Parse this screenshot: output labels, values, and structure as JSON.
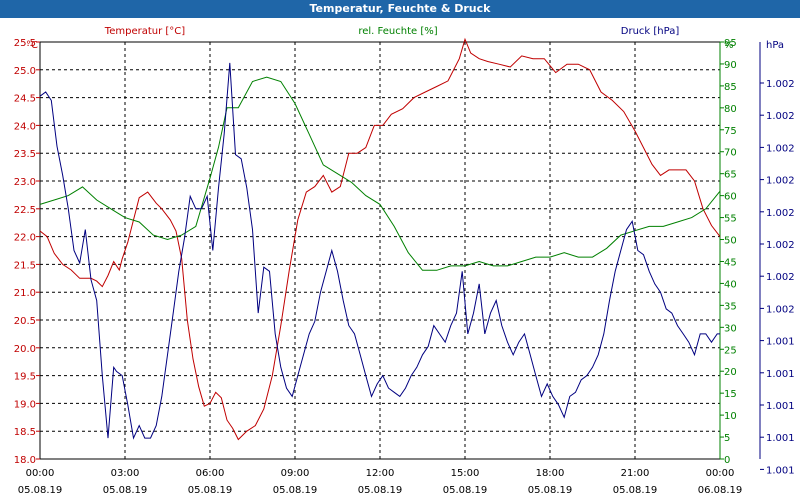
{
  "window": {
    "title": "Temperatur, Feuchte & Druck"
  },
  "chart_data": {
    "type": "line",
    "title": "Temperatur, Feuchte & Druck",
    "x_labels": [
      {
        "hour": 0,
        "time": "00:00",
        "date": "05.08.19"
      },
      {
        "hour": 3,
        "time": "03:00",
        "date": "05.08.19"
      },
      {
        "hour": 6,
        "time": "06:00",
        "date": "05.08.19"
      },
      {
        "hour": 9,
        "time": "09:00",
        "date": "05.08.19"
      },
      {
        "hour": 12,
        "time": "12:00",
        "date": "05.08.19"
      },
      {
        "hour": 15,
        "time": "15:00",
        "date": "05.08.19"
      },
      {
        "hour": 18,
        "time": "18:00",
        "date": "05.08.19"
      },
      {
        "hour": 21,
        "time": "21:00",
        "date": "05.08.19"
      },
      {
        "hour": 24,
        "time": "00:00",
        "date": "06.08.19"
      }
    ],
    "grid": true,
    "axes": {
      "left": {
        "unit": "°C",
        "min": 18.0,
        "max": 25.5,
        "step": 0.5
      },
      "middle": {
        "unit": "%",
        "min": 0,
        "max": 95,
        "step": 5
      },
      "right": {
        "unit": "hPa",
        "min": 0,
        "max": 1,
        "tick_label": "1.001 / 1.002",
        "ticks_right": [
          "1.002",
          "1.002",
          "1.002",
          "1.002",
          "1.002",
          "1.002",
          "1.002",
          "1.002",
          "1.001",
          "1.001",
          "1.001",
          "1.001",
          "1.001"
        ]
      }
    },
    "series": [
      {
        "name": "Temperatur [°C]",
        "axis": "left",
        "color": "#c00000",
        "x": [
          0,
          0.25,
          0.5,
          0.8,
          1.1,
          1.4,
          1.6,
          1.8,
          2.0,
          2.2,
          2.4,
          2.6,
          2.8,
          2.9,
          3.1,
          3.3,
          3.5,
          3.8,
          4.1,
          4.3,
          4.6,
          4.8,
          5.0,
          5.2,
          5.4,
          5.6,
          5.8,
          6.0,
          6.2,
          6.4,
          6.6,
          6.8,
          7.0,
          7.3,
          7.6,
          7.9,
          8.2,
          8.5,
          8.8,
          9.1,
          9.4,
          9.7,
          10.0,
          10.3,
          10.6,
          10.9,
          11.2,
          11.5,
          11.8,
          12.1,
          12.4,
          12.8,
          13.2,
          13.6,
          14.0,
          14.4,
          14.8,
          15.0,
          15.2,
          15.5,
          15.8,
          16.2,
          16.6,
          17.0,
          17.4,
          17.8,
          18.2,
          18.6,
          19.0,
          19.4,
          19.8,
          20.2,
          20.6,
          21.0,
          21.3,
          21.6,
          21.9,
          22.2,
          22.5,
          22.8,
          23.1,
          23.4,
          23.7,
          24.0
        ],
        "values": [
          22.1,
          22.0,
          21.7,
          21.5,
          21.4,
          21.25,
          21.25,
          21.25,
          21.2,
          21.1,
          21.3,
          21.55,
          21.4,
          21.6,
          21.9,
          22.3,
          22.7,
          22.8,
          22.6,
          22.5,
          22.3,
          22.1,
          21.6,
          20.5,
          19.8,
          19.3,
          18.95,
          19.0,
          19.2,
          19.1,
          18.7,
          18.55,
          18.35,
          18.5,
          18.6,
          18.9,
          19.5,
          20.4,
          21.4,
          22.3,
          22.8,
          22.9,
          23.1,
          22.8,
          22.9,
          23.5,
          23.5,
          23.6,
          24.0,
          24.0,
          24.2,
          24.3,
          24.5,
          24.6,
          24.7,
          24.8,
          25.2,
          25.55,
          25.3,
          25.2,
          25.15,
          25.1,
          25.05,
          25.25,
          25.2,
          25.2,
          24.95,
          25.1,
          25.1,
          25.0,
          24.6,
          24.45,
          24.25,
          23.9,
          23.6,
          23.3,
          23.1,
          23.2,
          23.2,
          23.2,
          23.0,
          22.5,
          22.2,
          22.0
        ]
      },
      {
        "name": "rel. Feuchte [%]",
        "axis": "middle",
        "color": "#008000",
        "x": [
          0,
          0.5,
          1.0,
          1.5,
          2.0,
          2.5,
          3.0,
          3.5,
          4.0,
          4.5,
          5.0,
          5.5,
          6.0,
          6.3,
          6.6,
          7.0,
          7.5,
          8.0,
          8.5,
          9.0,
          9.5,
          10.0,
          10.5,
          11.0,
          11.5,
          12.0,
          12.5,
          13.0,
          13.5,
          14.0,
          14.5,
          15.0,
          15.5,
          16.0,
          16.5,
          17.0,
          17.5,
          18.0,
          18.5,
          19.0,
          19.5,
          20.0,
          20.5,
          21.0,
          21.5,
          22.0,
          22.5,
          23.0,
          23.5,
          24.0
        ],
        "values": [
          58,
          59,
          60,
          62,
          59,
          57,
          55,
          54,
          51,
          50,
          51,
          53,
          64,
          71,
          80,
          80,
          86,
          87,
          86,
          81,
          74,
          67,
          65,
          63,
          60,
          58,
          53,
          47,
          43,
          43,
          44,
          44,
          45,
          44,
          44,
          45,
          46,
          46,
          47,
          46,
          46,
          48,
          51,
          52,
          53,
          53,
          54,
          55,
          57,
          61
        ]
      },
      {
        "name": "Druck [hPa]",
        "axis": "right",
        "color": "#000080",
        "x": [
          0,
          0.2,
          0.4,
          0.6,
          0.8,
          1.0,
          1.2,
          1.4,
          1.6,
          1.8,
          2.0,
          2.2,
          2.4,
          2.6,
          2.7,
          2.9,
          3.1,
          3.3,
          3.5,
          3.7,
          3.9,
          4.1,
          4.3,
          4.5,
          4.7,
          4.9,
          5.1,
          5.3,
          5.5,
          5.7,
          5.9,
          6.1,
          6.3,
          6.5,
          6.7,
          6.9,
          7.1,
          7.3,
          7.5,
          7.7,
          7.9,
          8.1,
          8.3,
          8.5,
          8.7,
          8.9,
          9.1,
          9.3,
          9.5,
          9.7,
          9.9,
          10.1,
          10.3,
          10.5,
          10.7,
          10.9,
          11.1,
          11.3,
          11.5,
          11.7,
          11.9,
          12.1,
          12.3,
          12.5,
          12.7,
          12.9,
          13.1,
          13.3,
          13.5,
          13.7,
          13.9,
          14.1,
          14.3,
          14.5,
          14.7,
          14.9,
          15.1,
          15.3,
          15.5,
          15.7,
          15.9,
          16.1,
          16.3,
          16.5,
          16.7,
          16.9,
          17.1,
          17.3,
          17.5,
          17.7,
          17.9,
          18.1,
          18.3,
          18.5,
          18.7,
          18.9,
          19.1,
          19.3,
          19.5,
          19.7,
          19.9,
          20.1,
          20.3,
          20.5,
          20.7,
          20.9,
          21.1,
          21.3,
          21.5,
          21.7,
          21.9,
          22.1,
          22.3,
          22.5,
          22.7,
          22.9,
          23.1,
          23.3,
          23.5,
          23.7,
          23.9,
          24.0
        ],
        "values": [
          0.87,
          0.88,
          0.86,
          0.75,
          0.68,
          0.6,
          0.5,
          0.47,
          0.55,
          0.43,
          0.38,
          0.2,
          0.05,
          0.22,
          0.21,
          0.2,
          0.13,
          0.05,
          0.08,
          0.05,
          0.05,
          0.08,
          0.15,
          0.25,
          0.35,
          0.45,
          0.53,
          0.63,
          0.6,
          0.6,
          0.63,
          0.5,
          0.65,
          0.78,
          0.95,
          0.73,
          0.72,
          0.65,
          0.55,
          0.35,
          0.46,
          0.45,
          0.3,
          0.22,
          0.17,
          0.15,
          0.2,
          0.25,
          0.3,
          0.33,
          0.4,
          0.45,
          0.5,
          0.45,
          0.38,
          0.32,
          0.3,
          0.25,
          0.2,
          0.15,
          0.18,
          0.2,
          0.17,
          0.16,
          0.15,
          0.17,
          0.2,
          0.22,
          0.25,
          0.27,
          0.32,
          0.3,
          0.28,
          0.32,
          0.35,
          0.45,
          0.3,
          0.35,
          0.42,
          0.3,
          0.35,
          0.38,
          0.32,
          0.28,
          0.25,
          0.28,
          0.3,
          0.25,
          0.2,
          0.15,
          0.18,
          0.15,
          0.13,
          0.1,
          0.15,
          0.16,
          0.19,
          0.2,
          0.22,
          0.25,
          0.3,
          0.38,
          0.45,
          0.5,
          0.55,
          0.57,
          0.5,
          0.49,
          0.45,
          0.42,
          0.4,
          0.36,
          0.35,
          0.32,
          0.3,
          0.28,
          0.25,
          0.3,
          0.3,
          0.28,
          0.3,
          0.3
        ]
      }
    ]
  }
}
